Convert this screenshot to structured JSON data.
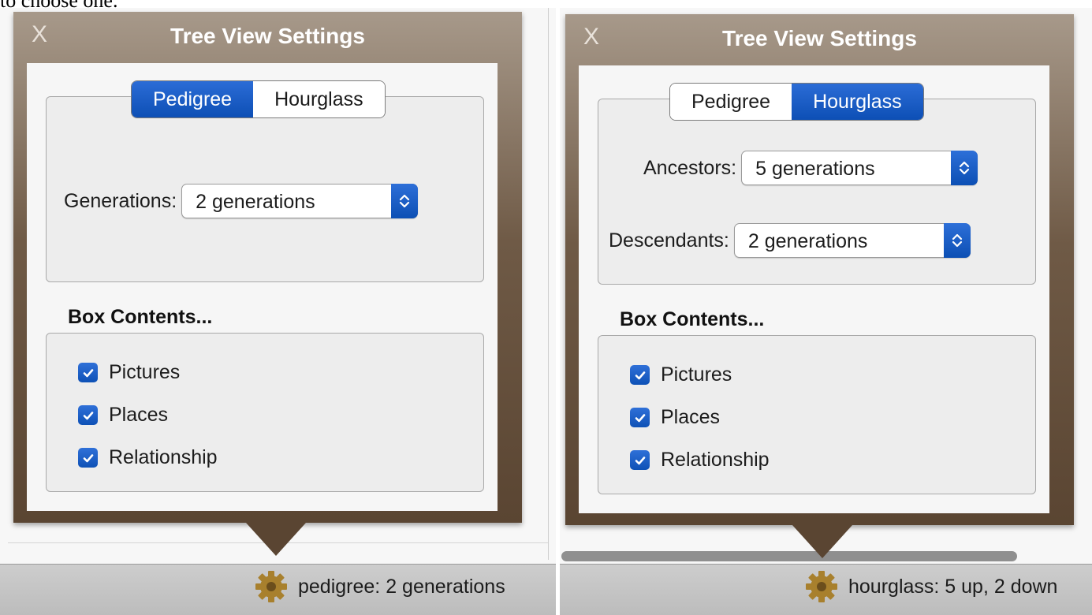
{
  "page": {
    "caption_fragment": "to choose one."
  },
  "left": {
    "popover": {
      "close_label": "X",
      "title": "Tree View Settings",
      "mode_tabs": [
        {
          "label": "Pedigree",
          "selected": true
        },
        {
          "label": "Hourglass",
          "selected": false
        }
      ],
      "generations": {
        "label": "Generations:",
        "value": "2 generations"
      },
      "box_contents": {
        "heading": "Box Contents...",
        "items": [
          {
            "label": "Pictures",
            "checked": true
          },
          {
            "label": "Places",
            "checked": true
          },
          {
            "label": "Relationship",
            "checked": true
          }
        ]
      }
    },
    "status": {
      "icon": "gear-icon",
      "text": "pedigree: 2 generations"
    }
  },
  "right": {
    "popover": {
      "close_label": "X",
      "title": "Tree View Settings",
      "mode_tabs": [
        {
          "label": "Pedigree",
          "selected": false
        },
        {
          "label": "Hourglass",
          "selected": true
        }
      ],
      "ancestors": {
        "label": "Ancestors:",
        "value": "5 generations"
      },
      "descendants": {
        "label": "Descendants:",
        "value": "2 generations"
      },
      "box_contents": {
        "heading": "Box Contents...",
        "items": [
          {
            "label": "Pictures",
            "checked": true
          },
          {
            "label": "Places",
            "checked": true
          },
          {
            "label": "Relationship",
            "checked": true
          }
        ]
      }
    },
    "status": {
      "icon": "gear-icon",
      "text": "hourglass: 5 up, 2 down"
    }
  },
  "colors": {
    "accent_blue": "#0d4fb5",
    "popover_brown": "#5a4532",
    "panel_bg": "#f6f6f6",
    "statusbar_bg": "#c6c6c6"
  }
}
